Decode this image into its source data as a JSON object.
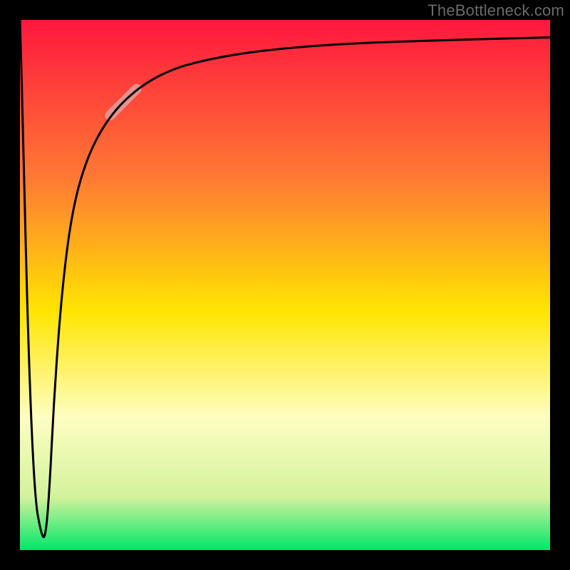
{
  "watermark": {
    "text": "TheBottleneck.com"
  },
  "chart_data": {
    "type": "line",
    "title": "",
    "xlabel": "",
    "ylabel": "",
    "xlim": [
      0,
      100
    ],
    "ylim": [
      0,
      100
    ],
    "legend": false,
    "grid": false,
    "background": {
      "gradient_stops": [
        {
          "pos": 0.0,
          "color": "#ff173e"
        },
        {
          "pos": 0.3,
          "color": "#ff7a33"
        },
        {
          "pos": 0.55,
          "color": "#ffe500"
        },
        {
          "pos": 0.75,
          "color": "#fdfec1"
        },
        {
          "pos": 0.9,
          "color": "#d3f29c"
        },
        {
          "pos": 1.0,
          "color": "#00e86a"
        }
      ]
    },
    "series": [
      {
        "name": "bottleneck-curve",
        "type": "line",
        "x": [
          0.0,
          0.5,
          1.5,
          2.75,
          4.0,
          4.75,
          5.5,
          6.5,
          8.0,
          10.0,
          13.0,
          17.0,
          22.0,
          28.0,
          35.0,
          45.0,
          60.0,
          80.0,
          100.0
        ],
        "values": [
          100.0,
          83.0,
          40.0,
          10.0,
          3.0,
          2.0,
          10.0,
          30.0,
          50.0,
          65.0,
          75.0,
          82.0,
          87.0,
          90.5,
          92.5,
          94.2,
          95.5,
          96.2,
          96.7
        ]
      }
    ],
    "highlight_segment": {
      "series": "bottleneck-curve",
      "x1": 17.0,
      "y1": 82.0,
      "x2": 22.0,
      "y2": 87.0,
      "color": "#e1a0a0",
      "width": 14
    }
  }
}
